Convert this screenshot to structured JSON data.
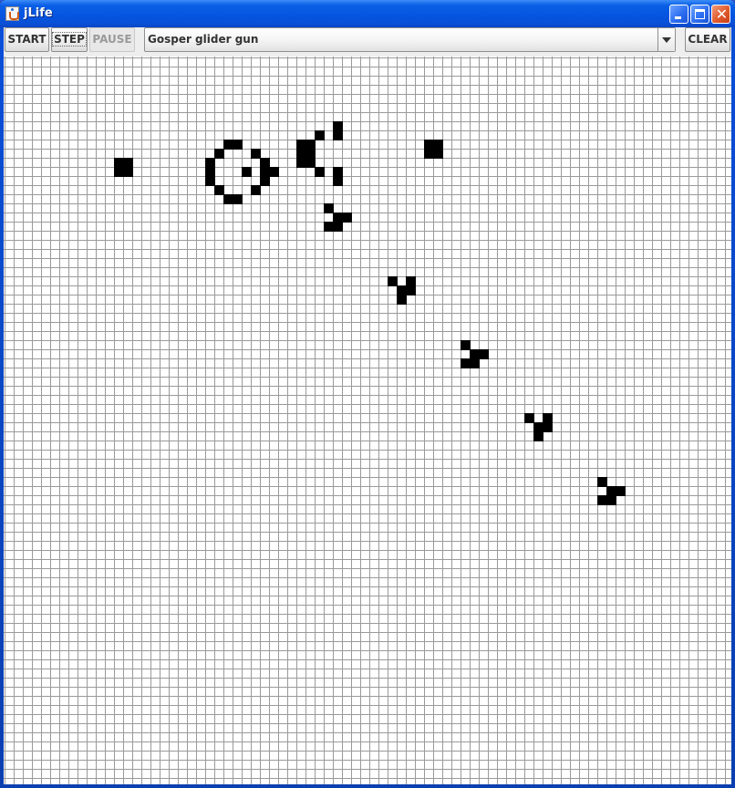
{
  "window": {
    "title": "jLife",
    "icon": "java-cup-icon",
    "controls": [
      "minimize-icon",
      "maximize-icon",
      "close-icon"
    ]
  },
  "toolbar": {
    "start_label": "START",
    "step_label": "STEP",
    "pause_label": "PAUSE",
    "pause_enabled": false,
    "pattern_selected": "Gosper glider gun",
    "clear_label": "CLEAR"
  },
  "board": {
    "cell_color": "#000000",
    "grid_color": "#9a9a9a",
    "background": "#ffffff",
    "live_cells": [
      [
        12,
        11
      ],
      [
        13,
        11
      ],
      [
        12,
        12
      ],
      [
        13,
        12
      ],
      [
        24,
        9
      ],
      [
        25,
        9
      ],
      [
        23,
        10
      ],
      [
        27,
        10
      ],
      [
        22,
        11
      ],
      [
        28,
        11
      ],
      [
        26,
        12
      ],
      [
        28,
        12
      ],
      [
        29,
        12
      ],
      [
        22,
        12
      ],
      [
        22,
        13
      ],
      [
        28,
        13
      ],
      [
        23,
        14
      ],
      [
        27,
        14
      ],
      [
        24,
        15
      ],
      [
        25,
        15
      ],
      [
        32,
        9
      ],
      [
        33,
        9
      ],
      [
        32,
        10
      ],
      [
        33,
        10
      ],
      [
        32,
        11
      ],
      [
        33,
        11
      ],
      [
        34,
        8
      ],
      [
        36,
        7
      ],
      [
        36,
        8
      ],
      [
        34,
        12
      ],
      [
        36,
        12
      ],
      [
        36,
        13
      ],
      [
        46,
        9
      ],
      [
        47,
        9
      ],
      [
        46,
        10
      ],
      [
        47,
        10
      ],
      [
        35,
        16
      ],
      [
        36,
        17
      ],
      [
        37,
        17
      ],
      [
        35,
        18
      ],
      [
        36,
        18
      ],
      [
        42,
        24
      ],
      [
        44,
        24
      ],
      [
        43,
        25
      ],
      [
        44,
        25
      ],
      [
        43,
        26
      ],
      [
        50,
        31
      ],
      [
        51,
        32
      ],
      [
        52,
        32
      ],
      [
        50,
        33
      ],
      [
        51,
        33
      ],
      [
        57,
        39
      ],
      [
        59,
        39
      ],
      [
        58,
        40
      ],
      [
        59,
        40
      ],
      [
        58,
        41
      ],
      [
        65,
        46
      ],
      [
        66,
        47
      ],
      [
        67,
        47
      ],
      [
        65,
        48
      ],
      [
        66,
        48
      ]
    ]
  }
}
